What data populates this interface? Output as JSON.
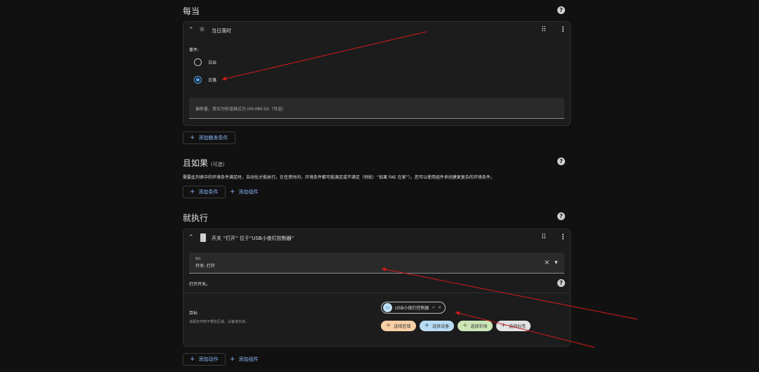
{
  "trigger_section": {
    "title": "每当",
    "card": {
      "title": "当日落时",
      "event_label": "事件:",
      "options": [
        "日出",
        "日落"
      ],
      "selected_option": "日落",
      "offset_placeholder": "偏移量，单位为秒或格式为 HH:MM:SS（可选）"
    },
    "add_button": "添加触发条件"
  },
  "condition_section": {
    "title": "且如果",
    "optional": "(可选)",
    "description": "需要此列表中的环境条件满足时，自动化才能执行。在任意时间，环境条件都可能满足或不满足（例如：“如果 FAE 在家”）。您可以使用组件来创建更复杂的环境条件。",
    "add_condition": "添加条件",
    "add_block": "添加组件"
  },
  "action_section": {
    "title": "就执行",
    "card": {
      "title": "开关 “打开” 位于“USB小夜灯控制器”",
      "service_label": "服务",
      "service_value": "开关: 打开",
      "service_description": "打开开关。",
      "target_label": "目标",
      "target_hint": "该服务作用于哪些区域、设备或实体。",
      "entity_chip": "USB小夜灯控制器",
      "pickers": [
        {
          "label": "选择区域",
          "color": "#f6cfa6"
        },
        {
          "label": "选择设备",
          "color": "#b9dcf3"
        },
        {
          "label": "选择实体",
          "color": "#cde6b7"
        },
        {
          "label": "选择标签",
          "color": "#e3e3e3"
        }
      ]
    },
    "add_action": "添加动作",
    "add_block": "添加组件"
  },
  "colors": {
    "accent": "#8ab4f8",
    "radio_selected": "#4fa3f0",
    "annotation_arrow": "#d11b1b"
  },
  "icons": [
    "help-icon",
    "chevron-up-icon",
    "sun-icon",
    "drag-handle-icon",
    "more-vert-icon",
    "switch-icon",
    "clear-icon",
    "dropdown-icon",
    "entity-icon",
    "plus-icon"
  ]
}
